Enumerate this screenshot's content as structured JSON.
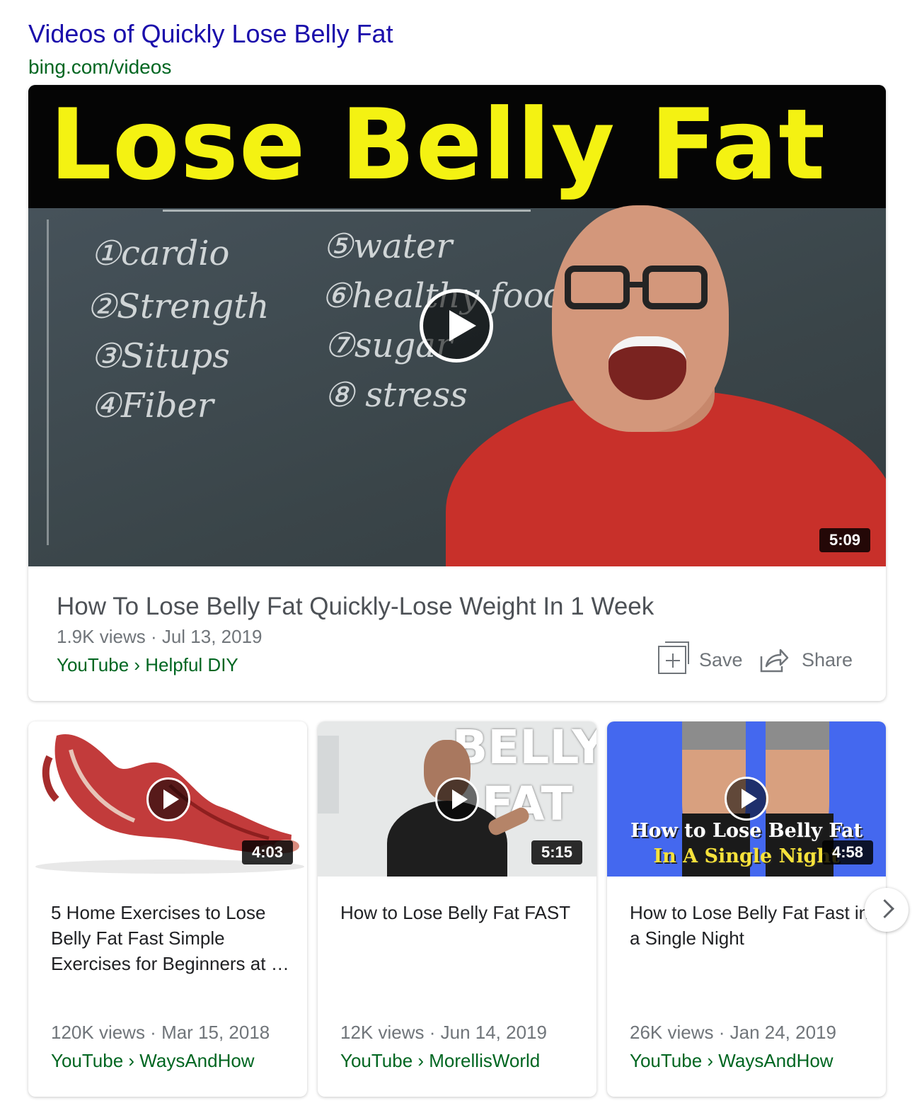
{
  "header": {
    "title": "Videos of Quickly Lose Belly Fat",
    "url": "bing.com/videos"
  },
  "featured": {
    "thumbnail_banner": "Lose Belly Fat",
    "chalkboard": [
      "①cardio",
      "②Strength",
      "③Situps",
      "④Fiber",
      "⑤water",
      "⑥healthy foods",
      "⑦sugar",
      "⑧ stress"
    ],
    "duration": "5:09",
    "title": "How To Lose Belly Fat Quickly-Lose Weight In 1 Week",
    "meta": "1.9K views · Jul 13, 2019",
    "source": "YouTube › Helpful DIY",
    "save_label": "Save",
    "share_label": "Share",
    "icons": {
      "play": "play-icon",
      "save": "save-icon",
      "share": "share-icon"
    }
  },
  "videos": [
    {
      "duration": "4:03",
      "title": "5 Home Exercises to Lose Belly Fat Fast Simple Exercises for Beginners at …",
      "meta": "120K views · Mar 15, 2018",
      "source": "YouTube › WaysAndHow"
    },
    {
      "duration": "5:15",
      "overlay_text": [
        "BELLY",
        "FAT"
      ],
      "title": "How to Lose Belly Fat FAST",
      "meta": "12K views · Jun 14, 2019",
      "source": "YouTube › MorellisWorld"
    },
    {
      "duration": "4:58",
      "overlay_text": [
        "How to Lose Belly Fat",
        "In A Single Night"
      ],
      "title": "How to Lose Belly Fat Fast in a Single Night",
      "meta": "26K views · Jan 24, 2019",
      "source": "YouTube › WaysAndHow"
    }
  ],
  "carousel": {
    "next_icon": "chevron-right-icon"
  },
  "colors": {
    "title_link": "#1a0dab",
    "source_green": "#006621",
    "meta_gray": "#70757a",
    "banner_yellow": "#f4f212",
    "thumb3_blue": "#4468ef"
  }
}
